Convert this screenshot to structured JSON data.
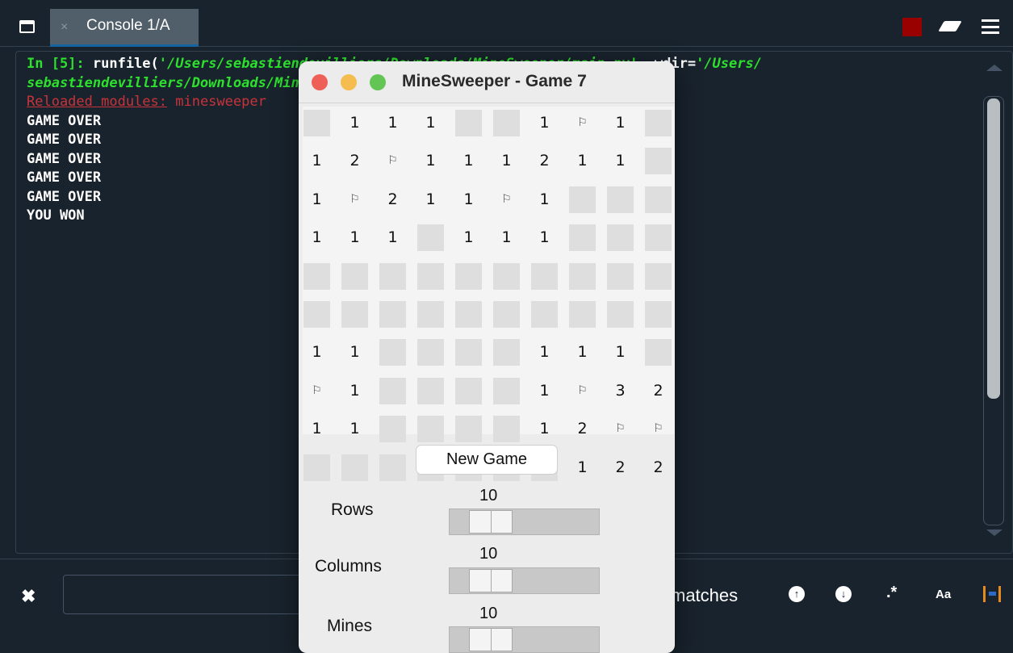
{
  "topbar": {
    "tab_label": "Console 1/A",
    "tab_close": "×"
  },
  "console": {
    "prompt": "In [5]:",
    "command": " runfile(",
    "path_arg": "'/Users/sebastiendevilliers/Downloads/MineSweeper/main.py'",
    "sep": ", wdir=",
    "wdir_start": "'/Users/",
    "wdir_cont": "sebastiendevilliers/Downloads/MineSweeper'",
    "wdir_end": ")",
    "reloaded_label": "Reloaded modules:",
    "reloaded_mods": " minesweeper",
    "output": [
      "GAME OVER",
      "GAME OVER",
      "GAME OVER",
      "GAME OVER",
      "GAME OVER",
      "YOU WON"
    ]
  },
  "findbar": {
    "close_glyph": "✖",
    "input_value": "",
    "matches_label": "matches",
    "up_glyph": "↑",
    "down_glyph": "↓",
    "regex_glyph": ".*",
    "case_glyph": "Aa"
  },
  "minesweeper": {
    "title": "MineSweeper - Game 7",
    "board": [
      [
        "#",
        "1",
        "1",
        "1",
        "#",
        "#",
        "1",
        "F",
        "1",
        "#"
      ],
      [
        "1",
        "2",
        "F",
        "1",
        "1",
        "1",
        "2",
        "1",
        "1",
        "#"
      ],
      [
        "1",
        "F",
        "2",
        "1",
        "1",
        "F",
        "1",
        "#",
        "#",
        "#"
      ],
      [
        "1",
        "1",
        "1",
        "#",
        "1",
        "1",
        "1",
        "#",
        "#",
        "#"
      ],
      [
        "#",
        "#",
        "#",
        "#",
        "#",
        "#",
        "#",
        "#",
        "#",
        "#"
      ],
      [
        "#",
        "#",
        "#",
        "#",
        "#",
        "#",
        "#",
        "#",
        "#",
        "#"
      ],
      [
        "1",
        "1",
        "#",
        "#",
        "#",
        "#",
        "1",
        "1",
        "1",
        "#"
      ],
      [
        "F",
        "1",
        "#",
        "#",
        "#",
        "#",
        "1",
        "F",
        "3",
        "2"
      ],
      [
        "1",
        "1",
        "#",
        "#",
        "#",
        "#",
        "1",
        "2",
        "F",
        "F"
      ],
      [
        "#",
        "#",
        "#",
        "#",
        "#",
        "#",
        "#",
        "1",
        "2",
        "2"
      ]
    ],
    "flag_glyph": "⚐",
    "new_game_label": "New Game",
    "sliders": [
      {
        "label": "Rows",
        "value": "10"
      },
      {
        "label": "Columns",
        "value": "10"
      },
      {
        "label": "Mines",
        "value": "10"
      }
    ]
  }
}
